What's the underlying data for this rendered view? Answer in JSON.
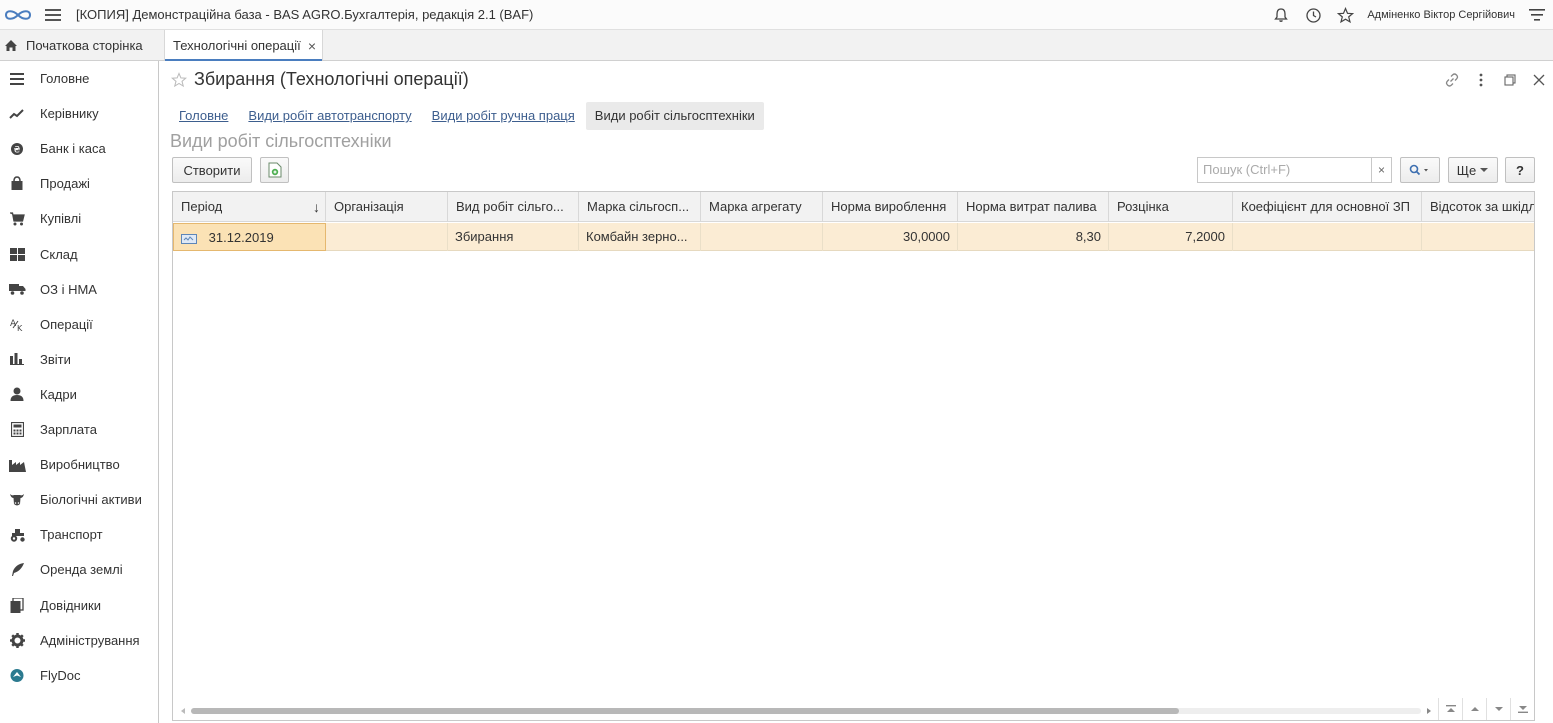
{
  "app": {
    "title": "[КОПИЯ] Демонстраційна база - BAS AGRO.Бухгалтерія, редакція 2.1  (BAF)",
    "user": "Адміненко Віктор Сергійович"
  },
  "tabs": {
    "home_label": "Початкова сторінка",
    "active_label": "Технологічні операції",
    "close_glyph": "×"
  },
  "sidebar": {
    "items": [
      {
        "label": "Головне",
        "icon": "menu-lines-icon"
      },
      {
        "label": "Керівнику",
        "icon": "trend-icon"
      },
      {
        "label": "Банк і каса",
        "icon": "coin-icon"
      },
      {
        "label": "Продажі",
        "icon": "bag-icon"
      },
      {
        "label": "Купівлі",
        "icon": "cart-icon"
      },
      {
        "label": "Склад",
        "icon": "warehouse-icon"
      },
      {
        "label": "ОЗ і НМА",
        "icon": "truck-icon"
      },
      {
        "label": "Операції",
        "icon": "operations-icon"
      },
      {
        "label": "Звіти",
        "icon": "bar-chart-icon"
      },
      {
        "label": "Кадри",
        "icon": "person-icon"
      },
      {
        "label": "Зарплата",
        "icon": "calculator-icon"
      },
      {
        "label": "Виробництво",
        "icon": "factory-icon"
      },
      {
        "label": "Біологічні активи",
        "icon": "cow-icon"
      },
      {
        "label": "Транспорт",
        "icon": "tractor-icon"
      },
      {
        "label": "Оренда землі",
        "icon": "feather-icon"
      },
      {
        "label": "Довідники",
        "icon": "books-icon"
      },
      {
        "label": "Адміністрування",
        "icon": "gear-icon"
      },
      {
        "label": "FlyDoc",
        "icon": "flydoc-icon"
      }
    ]
  },
  "form": {
    "title": "Збирання (Технологічні операції)",
    "sections": [
      "Головне",
      "Види робіт автотранспорту",
      "Види робіт ручна праця"
    ],
    "active_section": "Види робіт сільгосптехніки",
    "subtitle": "Види робіт сільгосптехніки"
  },
  "commands": {
    "create_label": "Створити",
    "search_placeholder": "Пошук (Ctrl+F)",
    "clear_glyph": "×",
    "more_label": "Ще",
    "help_label": "?"
  },
  "table": {
    "columns": [
      "Період",
      "Організація",
      "Вид робіт сільго...",
      "Марка сільгосп...",
      "Марка агрегату",
      "Норма вироблення",
      "Норма витрат палива",
      "Розцінка",
      "Коефіцієнт для основної ЗП",
      "Відсоток за шкідл"
    ],
    "sort_glyph": "↓",
    "rows": [
      {
        "period": "31.12.2019",
        "organization": "",
        "work_type": "Збирання",
        "machine_brand": "Комбайн зерно...",
        "aggregate_brand": "",
        "output_norm": "30,0000",
        "fuel_norm": "8,30",
        "rate": "7,2000",
        "coefficient": "",
        "harmful_percent": ""
      }
    ]
  },
  "colors": {
    "accent": "#4a7dbf",
    "link": "#3d5e8e",
    "selected_row": "#fbecd4"
  }
}
